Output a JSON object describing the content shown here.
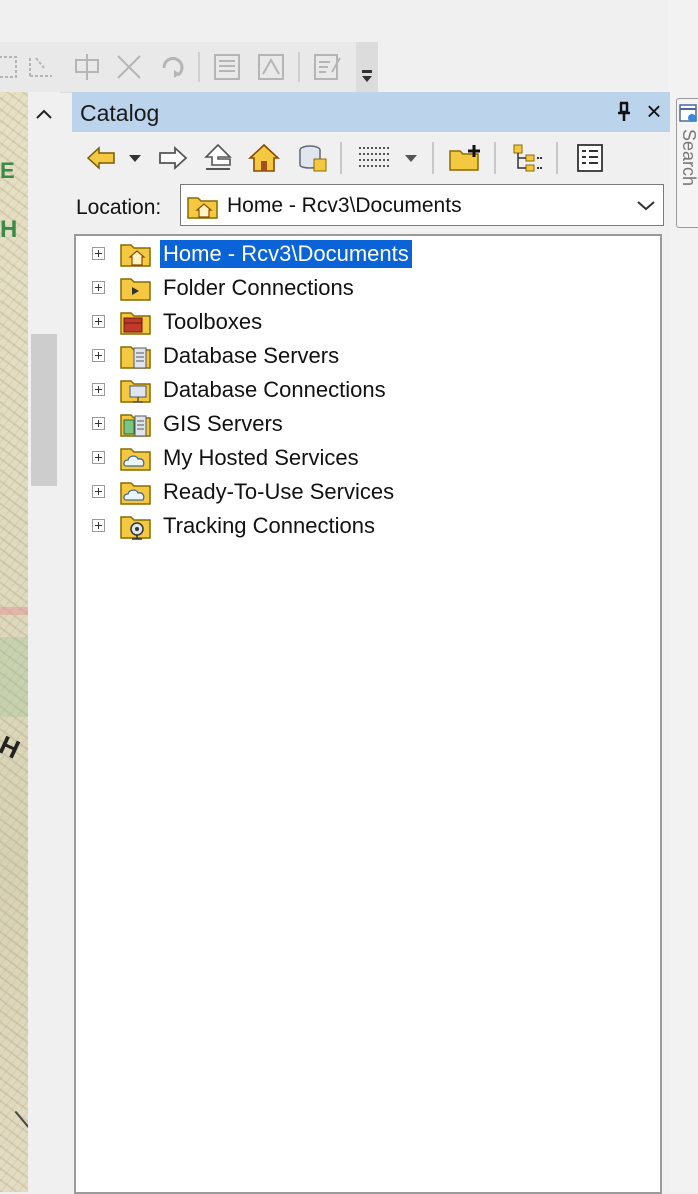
{
  "window": {
    "panel_title": "Catalog",
    "close_glyph": "×"
  },
  "location": {
    "label": "Location:",
    "value": "Home - Rcv3\\Documents"
  },
  "tree": {
    "items": [
      {
        "label": "Home - Rcv3\\Documents",
        "icon": "home-folder-icon",
        "selected": true
      },
      {
        "label": "Folder Connections",
        "icon": "folder-connections-icon",
        "selected": false
      },
      {
        "label": "Toolboxes",
        "icon": "toolbox-icon",
        "selected": false
      },
      {
        "label": "Database Servers",
        "icon": "database-server-icon",
        "selected": false
      },
      {
        "label": "Database Connections",
        "icon": "database-connection-icon",
        "selected": false
      },
      {
        "label": "GIS Servers",
        "icon": "gis-server-icon",
        "selected": false
      },
      {
        "label": "My Hosted Services",
        "icon": "hosted-services-icon",
        "selected": false
      },
      {
        "label": "Ready-To-Use Services",
        "icon": "ready-services-icon",
        "selected": false
      },
      {
        "label": "Tracking Connections",
        "icon": "tracking-connection-icon",
        "selected": false
      }
    ]
  },
  "search_tab": {
    "label": "Search"
  },
  "map": {
    "fragment_1": "E",
    "fragment_2": "H",
    "fragment_3": "H"
  },
  "colors": {
    "title_bar": "#bcd3ec",
    "selection": "#0a64d8",
    "folder": "#f2c94c"
  }
}
